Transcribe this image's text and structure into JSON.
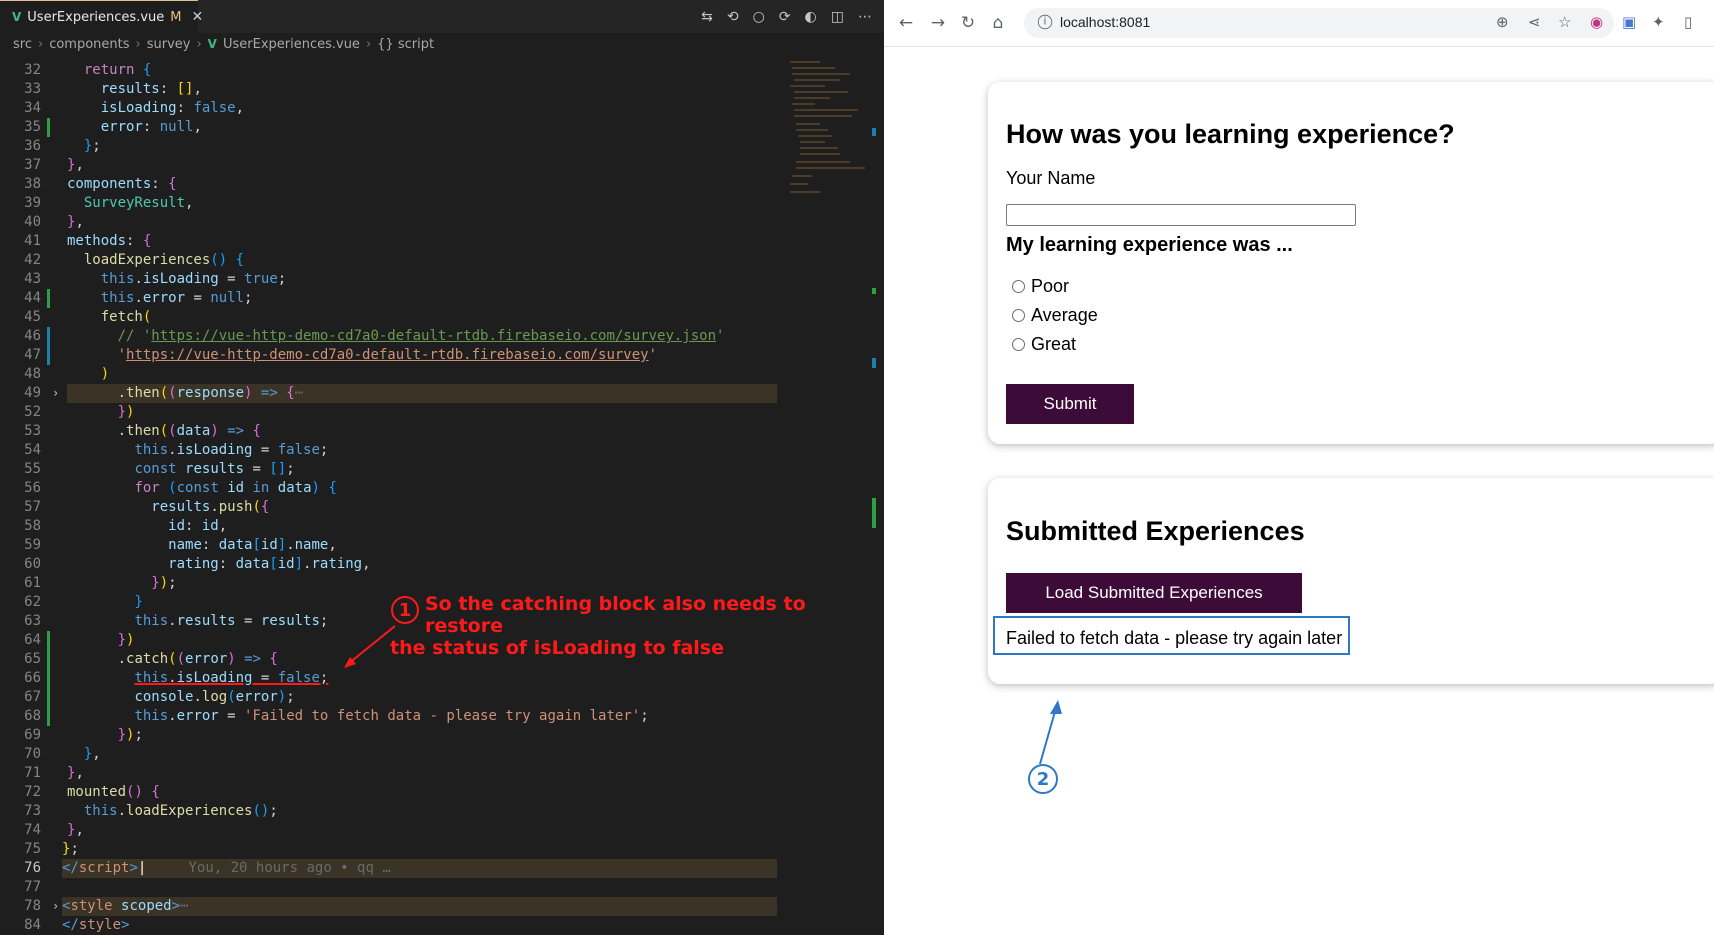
{
  "editor": {
    "tab": {
      "file": "UserExperiences.vue",
      "modified": "M"
    },
    "breadcrumb": [
      "src",
      "components",
      "survey",
      "UserExperiences.vue",
      "{} script"
    ],
    "annotation_number": "1",
    "annotation_text_line1": "So the catching block also needs to restore",
    "annotation_text_line2": "the status of isLoading to false",
    "blame": "You, 20 hours ago • qq …"
  },
  "browser": {
    "url": "localhost:8081",
    "survey_title": "How was you learning experience?",
    "name_label": "Your Name",
    "rating_heading": "My learning experience was ...",
    "options": [
      "Poor",
      "Average",
      "Great"
    ],
    "submit_label": "Submit",
    "results_title": "Submitted Experiences",
    "load_label": "Load Submitted Experiences",
    "error_message": "Failed to fetch data - please try again later",
    "annotation_number": "2"
  },
  "colors": {
    "button": "#3d0b37",
    "annotation_red": "#ff1a1a",
    "annotation_blue": "#2f78c4"
  }
}
